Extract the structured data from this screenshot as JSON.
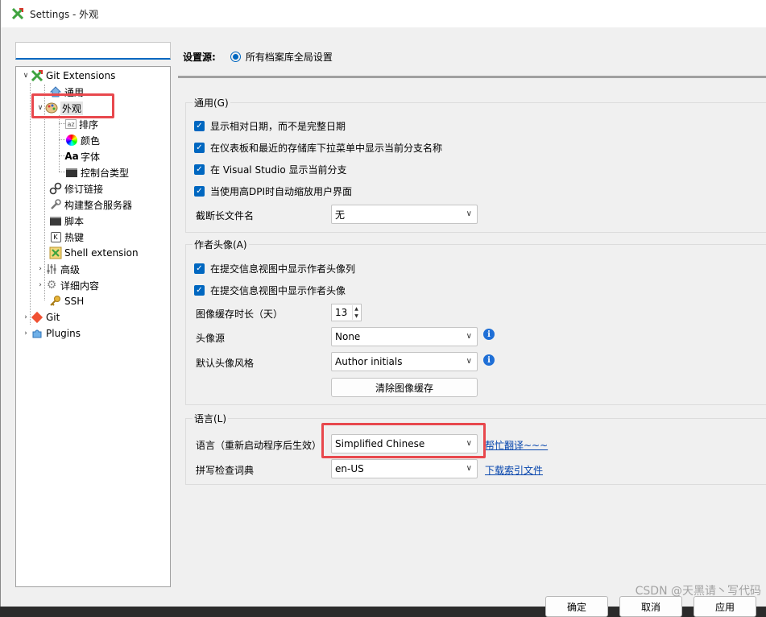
{
  "window": {
    "title": "Settings - 外观"
  },
  "tree": {
    "items": [
      {
        "label": "Git Extensions",
        "icon": "git-extensions-icon"
      },
      {
        "label": "通用",
        "icon": "home-icon"
      },
      {
        "label": "外观",
        "icon": "palette-icon"
      },
      {
        "label": "排序",
        "icon": "sort-icon"
      },
      {
        "label": "颜色",
        "icon": "color-wheel-icon"
      },
      {
        "label": "字体",
        "icon": "font-icon",
        "glyph": "Aa"
      },
      {
        "label": "控制台类型",
        "icon": "console-icon"
      },
      {
        "label": "修订链接",
        "icon": "link-icon"
      },
      {
        "label": "构建整合服务器",
        "icon": "wrench-icon"
      },
      {
        "label": "脚本",
        "icon": "script-icon"
      },
      {
        "label": "热键",
        "icon": "hotkey-icon"
      },
      {
        "label": "Shell extension",
        "icon": "shell-icon"
      },
      {
        "label": "高级",
        "icon": "advanced-icon"
      },
      {
        "label": "详细内容",
        "icon": "gear-icon"
      },
      {
        "label": "SSH",
        "icon": "key-icon"
      },
      {
        "label": "Git",
        "icon": "git-icon"
      },
      {
        "label": "Plugins",
        "icon": "plugins-icon"
      }
    ]
  },
  "source": {
    "label": "设置源:",
    "option": "所有档案库全局设置"
  },
  "general": {
    "title": "通用(G)",
    "checks": [
      "显示相对日期，而不是完整日期",
      "在仪表板和最近的存储库下拉菜单中显示当前分支名称",
      "在 Visual Studio 显示当前分支",
      "当使用高DPI时自动缩放用户界面"
    ],
    "truncate_label": "截断长文件名",
    "truncate_value": "无"
  },
  "avatar": {
    "title": "作者头像(A)",
    "checks": [
      "在提交信息视图中显示作者头像列",
      "在提交信息视图中显示作者头像"
    ],
    "cache_label": "图像缓存时长（天）",
    "cache_value": "13",
    "source_label": "头像源",
    "source_value": "None",
    "style_label": "默认头像风格",
    "style_value": "Author initials",
    "clear_button": "清除图像缓存"
  },
  "language": {
    "title": "语言(L)",
    "lang_label": "语言（重新启动程序后生效）",
    "lang_value": "Simplified Chinese",
    "help_link": "帮忙翻译~~~",
    "spell_label": "拼写检查词典",
    "spell_value": "en-US",
    "download_link": "下载索引文件"
  },
  "footer": {
    "ok": "确定",
    "cancel": "取消",
    "apply": "应用"
  },
  "watermark": "CSDN @天黑请丶写代码",
  "colors": {
    "accent": "#0067c0",
    "highlight": "#e8484d"
  }
}
